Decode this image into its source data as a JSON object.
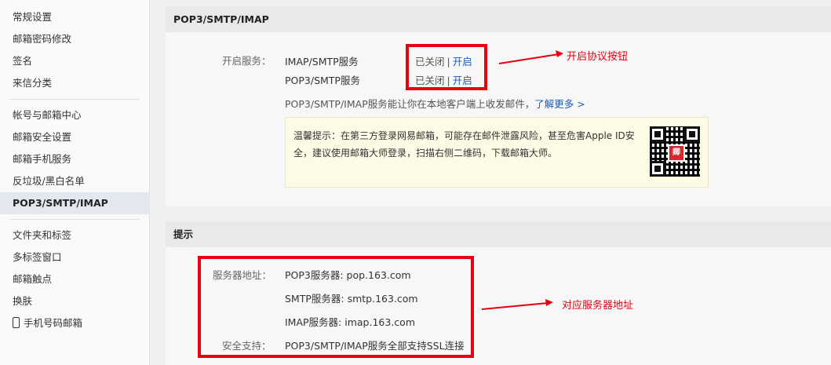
{
  "sidebar": {
    "groups": [
      [
        "常规设置",
        "邮箱密码修改",
        "签名",
        "来信分类"
      ],
      [
        "帐号与邮箱中心",
        "邮箱安全设置",
        "邮箱手机服务",
        "反垃圾/黑白名单",
        "POP3/SMTP/IMAP"
      ],
      [
        "文件夹和标签",
        "多标签窗口",
        "邮箱触点",
        "换肤",
        "手机号码邮箱"
      ]
    ],
    "active": "POP3/SMTP/IMAP"
  },
  "section1": {
    "title": "POP3/SMTP/IMAP",
    "enable_label": "开启服务：",
    "services": [
      {
        "name": "IMAP/SMTP服务",
        "status": "已关闭",
        "action": "开启"
      },
      {
        "name": "POP3/SMTP服务",
        "status": "已关闭",
        "action": "开启"
      }
    ],
    "sep": "|",
    "description": "POP3/SMTP/IMAP服务能让你在本地客户端上收发邮件，",
    "learn_more": "了解更多 >",
    "tip": "温馨提示：在第三方登录网易邮箱，可能存在邮件泄露风险，甚至危害Apple ID安全，建议使用邮箱大师登录，扫描右侧二维码，下载邮箱大师。",
    "qr_logo_text": "卿"
  },
  "section2": {
    "title": "提示",
    "server_label": "服务器地址：",
    "servers": [
      "POP3服务器: pop.163.com",
      "SMTP服务器: smtp.163.com",
      "IMAP服务器: imap.163.com"
    ],
    "security_label": "安全支持：",
    "security_text": "POP3/SMTP/IMAP服务全部支持SSL连接"
  },
  "annotations": {
    "a1": "开启协议按钮",
    "a2": "对应服务器地址"
  },
  "colors": {
    "accent": "#e60012",
    "link": "#1a5bbf"
  }
}
